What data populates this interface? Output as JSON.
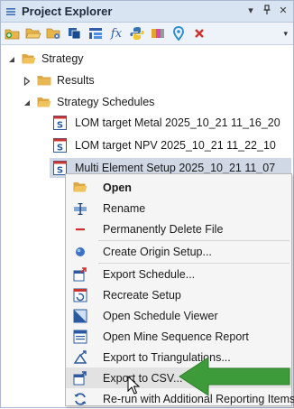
{
  "window": {
    "title": "Project Explorer",
    "pin_label": "▾",
    "pin_icon_label": "↑",
    "close_label": "✕"
  },
  "toolbar": {
    "icons": [
      "new-folder-icon",
      "open-folder-icon",
      "folder-settings-icon",
      "copy-icon",
      "tree-layout-icon",
      "function-icon",
      "python-icon",
      "palette-icon",
      "location-icon",
      "delete-icon"
    ],
    "function_glyph": "fx",
    "overflow_glyph": "▾"
  },
  "tree": {
    "root": {
      "label": "Strategy",
      "expanded": true
    },
    "results": {
      "label": "Results",
      "expanded": false
    },
    "schedules": {
      "label": "Strategy Schedules",
      "expanded": true
    },
    "files": [
      {
        "label": "LOM target Metal 2025_10_21 11_16_20"
      },
      {
        "label": "LOM target NPV 2025_10_21 11_22_10"
      },
      {
        "label": "Multi Element Setup 2025_10_21 11_07",
        "selected": true
      }
    ]
  },
  "context_menu": {
    "items": [
      {
        "label": "Open",
        "bold": true,
        "icon": "folder-icon"
      },
      {
        "label": "Rename",
        "icon": "rename-icon"
      },
      {
        "label": "Permanently Delete File",
        "icon": "delete-line-icon"
      },
      {
        "label": "Create Origin Setup...",
        "icon": "origin-icon"
      },
      {
        "label": "Export Schedule...",
        "icon": "export-schedule-icon"
      },
      {
        "label": "Recreate Setup",
        "icon": "recreate-icon"
      },
      {
        "label": "Open Schedule Viewer",
        "icon": "schedule-viewer-icon"
      },
      {
        "label": "Open Mine Sequence Report",
        "icon": "report-icon"
      },
      {
        "label": "Export to Triangulations...",
        "icon": "triangulation-icon"
      },
      {
        "label": "Export to CSV...",
        "icon": "export-csv-icon",
        "hover": true
      },
      {
        "label": "Re-run with Additional Reporting Items",
        "icon": "rerun-icon"
      }
    ]
  },
  "colors": {
    "annotation_arrow": "#3e9b3a",
    "selection": "#cfd8e4",
    "title_bar": "#d9e4f3"
  }
}
